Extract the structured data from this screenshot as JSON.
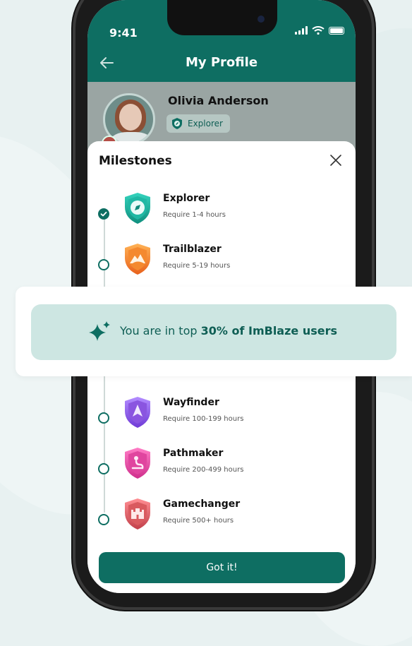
{
  "status_bar": {
    "time": "9:41"
  },
  "header": {
    "title": "My Profile"
  },
  "profile": {
    "name": "Olivia Anderson",
    "rank": "Explorer"
  },
  "milestones_sheet": {
    "title": "Milestones",
    "items": [
      {
        "name": "Explorer",
        "requirement": "Require 1-4 hours",
        "completed": true,
        "icon": "compass-shield-icon",
        "color": "#1fb3a1"
      },
      {
        "name": "Trailblazer",
        "requirement": "Require 5-19 hours",
        "completed": false,
        "icon": "mountain-shield-icon",
        "color": "#f07a2a"
      },
      {
        "name": "Wayfinder",
        "requirement": "Require 100-199 hours",
        "completed": false,
        "icon": "arrow-shield-icon",
        "color": "#8a55e0"
      },
      {
        "name": "Pathmaker",
        "requirement": "Require 200-499 hours",
        "completed": false,
        "icon": "path-shield-icon",
        "color": "#e0459f"
      },
      {
        "name": "Gamechanger",
        "requirement": "Require 500+ hours",
        "completed": false,
        "icon": "castle-shield-icon",
        "color": "#d95a5f"
      }
    ],
    "button_label": "Got it!"
  },
  "banner": {
    "prefix": "You are in top ",
    "highlight": "30% of ImBlaze users"
  },
  "colors": {
    "primary": "#0e6e62",
    "banner_bg": "#cde6e2"
  }
}
